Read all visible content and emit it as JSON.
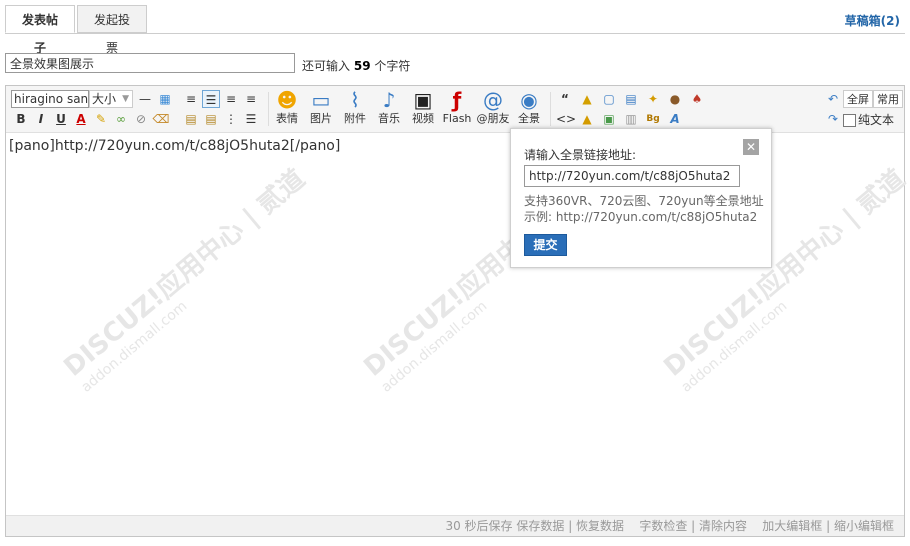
{
  "tabs": [
    {
      "label": "发表帖子"
    },
    {
      "label": "发起投票"
    }
  ],
  "drafts_label": "草稿箱(2)",
  "subject": {
    "value": "全景效果图展示"
  },
  "remain": {
    "prefix": "还可输入",
    "count": "59",
    "suffix": "个字符"
  },
  "toolbar": {
    "font_value": "hiragino sans",
    "size_value": "大小",
    "big_buttons": [
      {
        "label": "表情",
        "icon": "smile-icon"
      },
      {
        "label": "图片",
        "icon": "image-icon"
      },
      {
        "label": "附件",
        "icon": "paperclip-icon"
      },
      {
        "label": "音乐",
        "icon": "music-icon"
      },
      {
        "label": "视频",
        "icon": "video-icon"
      },
      {
        "label": "Flash",
        "icon": "flash-icon"
      },
      {
        "label": "@朋友",
        "icon": "at-icon"
      },
      {
        "label": "全景",
        "icon": "eye-icon"
      }
    ],
    "fullscreen_label": "全屏",
    "common_label": "常用",
    "plaintext_label": "纯文本"
  },
  "content": "[pano]http://720yun.com/t/c88jO5huta2[/pano]",
  "watermark": {
    "brand": "DISCUZ!应用中心 | 贰道",
    "url": "addon.dismall.com"
  },
  "popup": {
    "title": "请输入全景链接地址:",
    "input_value": "http://720yun.com/t/c88jO5huta2",
    "hint1": "支持360VR、720云图、720yun等全景地址",
    "hint2": "示例: http://720yun.com/t/c88jO5huta2",
    "submit": "提交"
  },
  "status": {
    "autosave": "30 秒后保存",
    "save": "保存数据",
    "restore": "恢复数据",
    "count": "字数检查",
    "clear": "清除内容",
    "enlarge": "加大编辑框",
    "shrink": "缩小编辑框"
  },
  "colors": {
    "accent": "#2a6eb8",
    "link": "#2366a8"
  }
}
